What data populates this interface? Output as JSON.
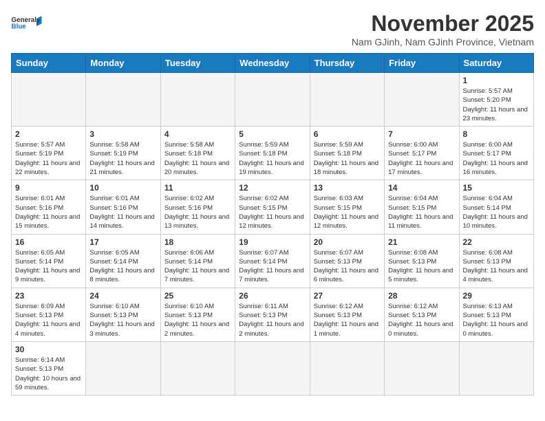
{
  "logo": {
    "line1": "General",
    "line2": "Blue"
  },
  "header": {
    "title": "November 2025",
    "subtitle": "Nam GJinh, Nam GJinh Province, Vietnam"
  },
  "weekdays": [
    "Sunday",
    "Monday",
    "Tuesday",
    "Wednesday",
    "Thursday",
    "Friday",
    "Saturday"
  ],
  "days": [
    {
      "date": null,
      "info": ""
    },
    {
      "date": null,
      "info": ""
    },
    {
      "date": null,
      "info": ""
    },
    {
      "date": null,
      "info": ""
    },
    {
      "date": null,
      "info": ""
    },
    {
      "date": null,
      "info": ""
    },
    {
      "date": "1",
      "info": "Sunrise: 5:57 AM\nSunset: 5:20 PM\nDaylight: 11 hours and 23 minutes."
    },
    {
      "date": "2",
      "info": "Sunrise: 5:57 AM\nSunset: 5:19 PM\nDaylight: 11 hours and 22 minutes."
    },
    {
      "date": "3",
      "info": "Sunrise: 5:58 AM\nSunset: 5:19 PM\nDaylight: 11 hours and 21 minutes."
    },
    {
      "date": "4",
      "info": "Sunrise: 5:58 AM\nSunset: 5:18 PM\nDaylight: 11 hours and 20 minutes."
    },
    {
      "date": "5",
      "info": "Sunrise: 5:59 AM\nSunset: 5:18 PM\nDaylight: 11 hours and 19 minutes."
    },
    {
      "date": "6",
      "info": "Sunrise: 5:59 AM\nSunset: 5:18 PM\nDaylight: 11 hours and 18 minutes."
    },
    {
      "date": "7",
      "info": "Sunrise: 6:00 AM\nSunset: 5:17 PM\nDaylight: 11 hours and 17 minutes."
    },
    {
      "date": "8",
      "info": "Sunrise: 6:00 AM\nSunset: 5:17 PM\nDaylight: 11 hours and 16 minutes."
    },
    {
      "date": "9",
      "info": "Sunrise: 6:01 AM\nSunset: 5:16 PM\nDaylight: 11 hours and 15 minutes."
    },
    {
      "date": "10",
      "info": "Sunrise: 6:01 AM\nSunset: 5:16 PM\nDaylight: 11 hours and 14 minutes."
    },
    {
      "date": "11",
      "info": "Sunrise: 6:02 AM\nSunset: 5:16 PM\nDaylight: 11 hours and 13 minutes."
    },
    {
      "date": "12",
      "info": "Sunrise: 6:02 AM\nSunset: 5:15 PM\nDaylight: 11 hours and 12 minutes."
    },
    {
      "date": "13",
      "info": "Sunrise: 6:03 AM\nSunset: 5:15 PM\nDaylight: 11 hours and 12 minutes."
    },
    {
      "date": "14",
      "info": "Sunrise: 6:04 AM\nSunset: 5:15 PM\nDaylight: 11 hours and 11 minutes."
    },
    {
      "date": "15",
      "info": "Sunrise: 6:04 AM\nSunset: 5:14 PM\nDaylight: 11 hours and 10 minutes."
    },
    {
      "date": "16",
      "info": "Sunrise: 6:05 AM\nSunset: 5:14 PM\nDaylight: 11 hours and 9 minutes."
    },
    {
      "date": "17",
      "info": "Sunrise: 6:05 AM\nSunset: 5:14 PM\nDaylight: 11 hours and 8 minutes."
    },
    {
      "date": "18",
      "info": "Sunrise: 6:06 AM\nSunset: 5:14 PM\nDaylight: 11 hours and 7 minutes."
    },
    {
      "date": "19",
      "info": "Sunrise: 6:07 AM\nSunset: 5:14 PM\nDaylight: 11 hours and 7 minutes."
    },
    {
      "date": "20",
      "info": "Sunrise: 6:07 AM\nSunset: 5:13 PM\nDaylight: 11 hours and 6 minutes."
    },
    {
      "date": "21",
      "info": "Sunrise: 6:08 AM\nSunset: 5:13 PM\nDaylight: 11 hours and 5 minutes."
    },
    {
      "date": "22",
      "info": "Sunrise: 6:08 AM\nSunset: 5:13 PM\nDaylight: 11 hours and 4 minutes."
    },
    {
      "date": "23",
      "info": "Sunrise: 6:09 AM\nSunset: 5:13 PM\nDaylight: 11 hours and 4 minutes."
    },
    {
      "date": "24",
      "info": "Sunrise: 6:10 AM\nSunset: 5:13 PM\nDaylight: 11 hours and 3 minutes."
    },
    {
      "date": "25",
      "info": "Sunrise: 6:10 AM\nSunset: 5:13 PM\nDaylight: 11 hours and 2 minutes."
    },
    {
      "date": "26",
      "info": "Sunrise: 6:11 AM\nSunset: 5:13 PM\nDaylight: 11 hours and 2 minutes."
    },
    {
      "date": "27",
      "info": "Sunrise: 6:12 AM\nSunset: 5:13 PM\nDaylight: 11 hours and 1 minute."
    },
    {
      "date": "28",
      "info": "Sunrise: 6:12 AM\nSunset: 5:13 PM\nDaylight: 11 hours and 0 minutes."
    },
    {
      "date": "29",
      "info": "Sunrise: 6:13 AM\nSunset: 5:13 PM\nDaylight: 11 hours and 0 minutes."
    },
    {
      "date": "30",
      "info": "Sunrise: 6:14 AM\nSunset: 5:13 PM\nDaylight: 10 hours and 59 minutes."
    },
    {
      "date": null,
      "info": ""
    },
    {
      "date": null,
      "info": ""
    },
    {
      "date": null,
      "info": ""
    },
    {
      "date": null,
      "info": ""
    },
    {
      "date": null,
      "info": ""
    },
    {
      "date": null,
      "info": ""
    }
  ]
}
